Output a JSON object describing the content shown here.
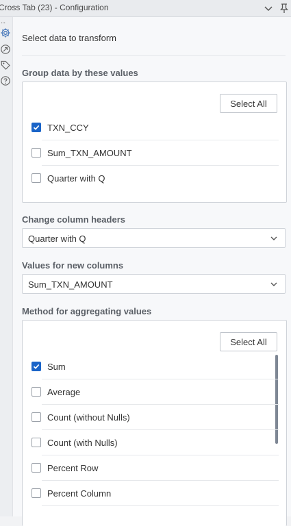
{
  "window": {
    "title": "Cross Tab (23) - Configuration"
  },
  "rail": {
    "dots": "...",
    "icons": [
      "gear-icon",
      "share-arrow-icon",
      "tag-icon",
      "help-icon"
    ]
  },
  "panel": {
    "subtitle": "Select data to transform",
    "group": {
      "label": "Group data by these values",
      "select_all": "Select All",
      "items": [
        {
          "label": "TXN_CCY",
          "checked": true
        },
        {
          "label": "Sum_TXN_AMOUNT",
          "checked": false
        },
        {
          "label": "Quarter with Q",
          "checked": false
        }
      ]
    },
    "headers": {
      "label": "Change column headers",
      "value": "Quarter with Q"
    },
    "values": {
      "label": "Values for new columns",
      "value": "Sum_TXN_AMOUNT"
    },
    "method": {
      "label": "Method for aggregating values",
      "select_all": "Select All",
      "items": [
        {
          "label": "Sum",
          "checked": true
        },
        {
          "label": "Average",
          "checked": false
        },
        {
          "label": "Count (without Nulls)",
          "checked": false
        },
        {
          "label": "Count (with Nulls)",
          "checked": false
        },
        {
          "label": "Percent Row",
          "checked": false
        },
        {
          "label": "Percent Column",
          "checked": false
        }
      ]
    }
  },
  "colors": {
    "accent": "#1a64c8",
    "background": "#f7f8fa"
  }
}
